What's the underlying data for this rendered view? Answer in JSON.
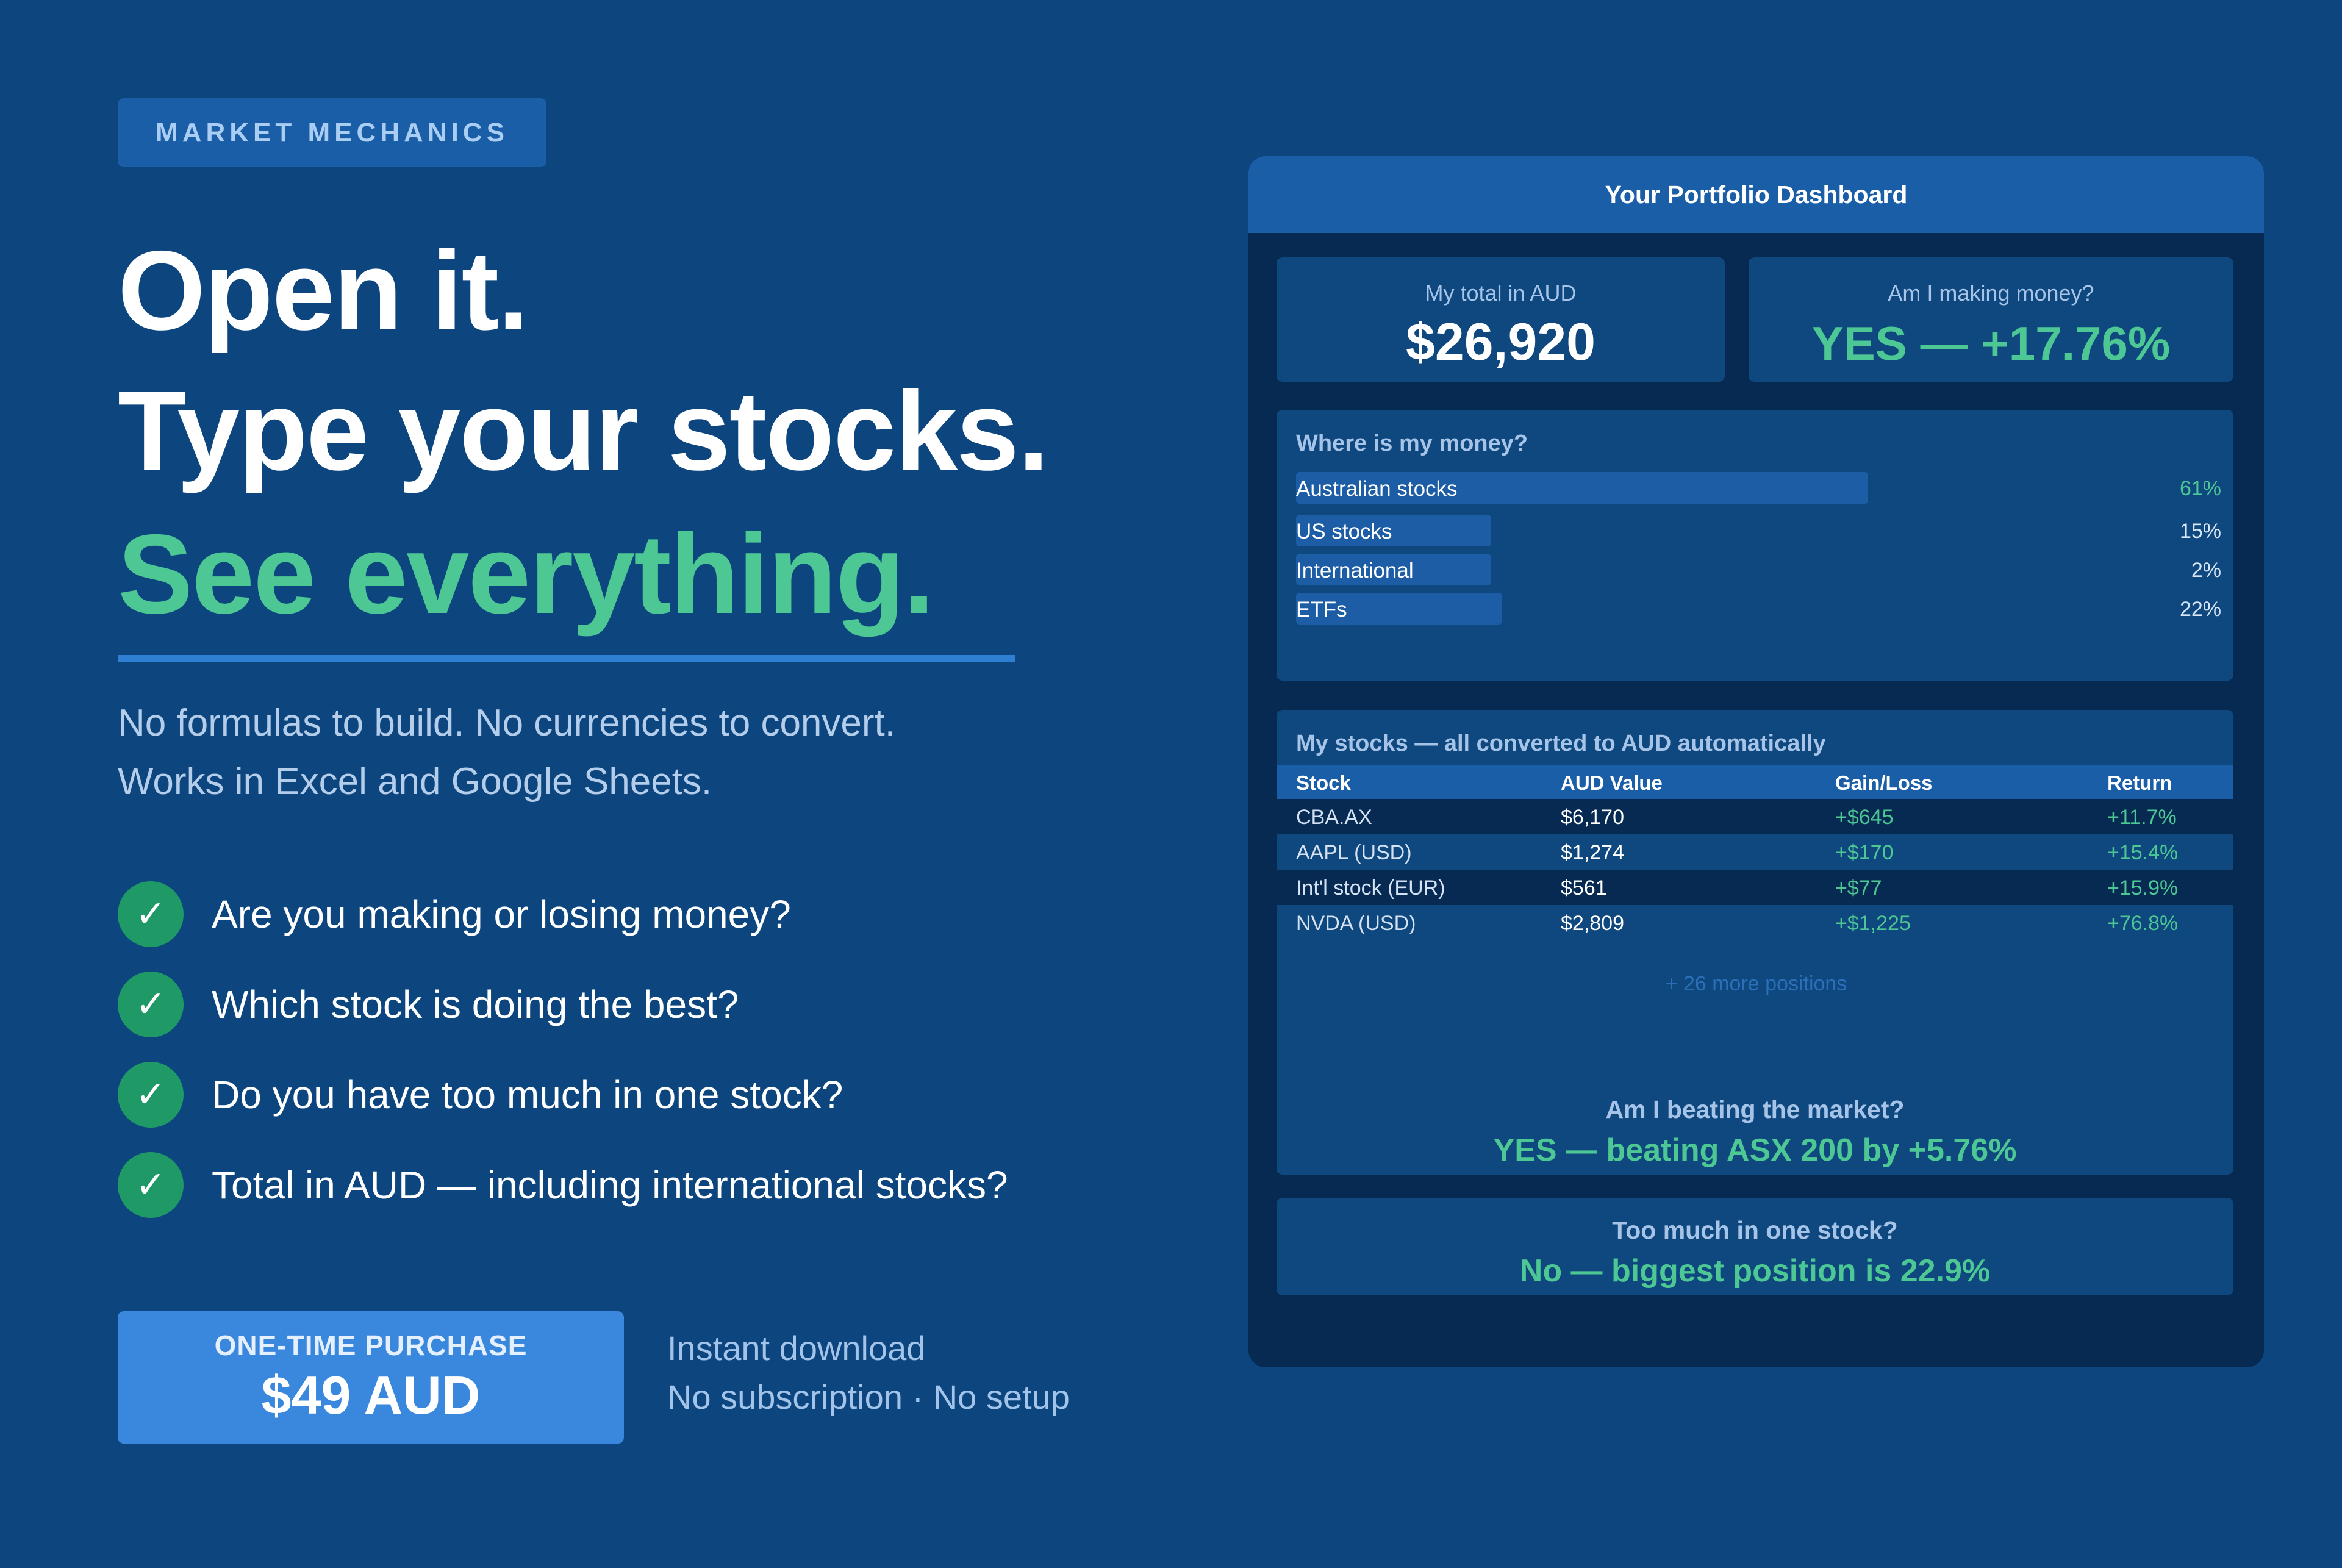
{
  "badge": "MARKET MECHANICS",
  "headline": {
    "line1": "Open it.",
    "line2": "Type your stocks.",
    "line3": "See everything."
  },
  "subtext": {
    "line1": "No formulas to build. No currencies to convert.",
    "line2": "Works in Excel and Google Sheets."
  },
  "checklist": [
    "Are you making or losing money?",
    "Which stock is doing the best?",
    "Do you have too much in one stock?",
    "Total in AUD — including international stocks?"
  ],
  "check_icon": "✓",
  "cta": {
    "top": "ONE-TIME PURCHASE",
    "price": "$49 AUD"
  },
  "meta": {
    "line1": "Instant download",
    "line2": "No subscription · No setup"
  },
  "dashboard": {
    "title": "Your Portfolio Dashboard",
    "total_label": "My total in AUD",
    "total_value": "$26,920",
    "making_label": "Am I making money?",
    "making_value": "YES — +17.76%",
    "allocation_title": "Where is my money?",
    "allocation": [
      {
        "label": "Australian stocks",
        "pct": "61%",
        "value": 61
      },
      {
        "label": "US stocks",
        "pct": "15%",
        "value": 15
      },
      {
        "label": "International",
        "pct": "2%",
        "value": 2
      },
      {
        "label": "ETFs",
        "pct": "22%",
        "value": 22
      }
    ],
    "stocks_title": "My stocks — all converted to AUD automatically",
    "columns": [
      "Stock",
      "AUD Value",
      "Gain/Loss",
      "Return"
    ],
    "rows": [
      [
        "CBA.AX",
        "$6,170",
        "+$645",
        "+11.7%"
      ],
      [
        "AAPL (USD)",
        "$1,274",
        "+$170",
        "+15.4%"
      ],
      [
        "Int'l stock (EUR)",
        "$561",
        "+$77",
        "+15.9%"
      ],
      [
        "NVDA (USD)",
        "$2,809",
        "+$1,225",
        "+76.8%"
      ]
    ],
    "more": "+ 26 more positions",
    "market_label": "Am I beating the market?",
    "market_value": "YES — beating ASX 200 by +5.76%",
    "concentration_label": "Too much in one stock?",
    "concentration_value": "No — biggest position is 22.9%"
  },
  "colors": {
    "background": "#0d467e",
    "accent_green": "#4dc894",
    "accent_blue": "#3a87de",
    "panel": "#062a52"
  }
}
